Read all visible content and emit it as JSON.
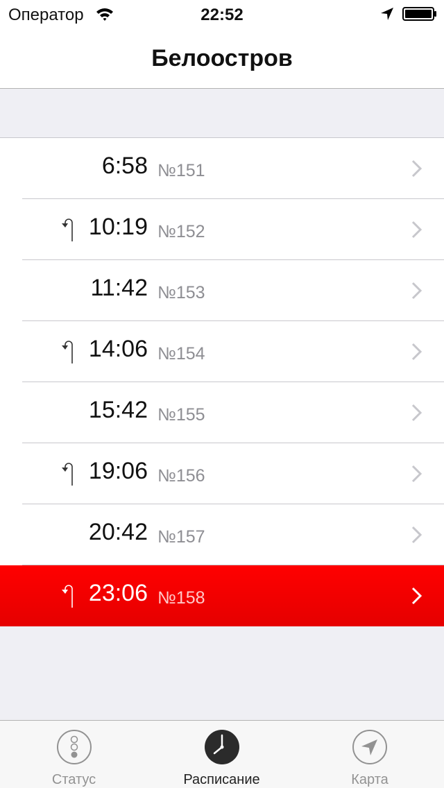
{
  "status_bar": {
    "carrier": "Оператор",
    "time": "22:52"
  },
  "nav": {
    "title": "Белоостров"
  },
  "rows": [
    {
      "time": "6:58",
      "number": "№151",
      "turn": false,
      "highlighted": false
    },
    {
      "time": "10:19",
      "number": "№152",
      "turn": true,
      "highlighted": false
    },
    {
      "time": "11:42",
      "number": "№153",
      "turn": false,
      "highlighted": false
    },
    {
      "time": "14:06",
      "number": "№154",
      "turn": true,
      "highlighted": false
    },
    {
      "time": "15:42",
      "number": "№155",
      "turn": false,
      "highlighted": false
    },
    {
      "time": "19:06",
      "number": "№156",
      "turn": true,
      "highlighted": false
    },
    {
      "time": "20:42",
      "number": "№157",
      "turn": false,
      "highlighted": false
    },
    {
      "time": "23:06",
      "number": "№158",
      "turn": true,
      "highlighted": true
    }
  ],
  "tabs": [
    {
      "label": "Статус",
      "icon": "traffic-light-icon",
      "active": false
    },
    {
      "label": "Расписание",
      "icon": "clock-icon",
      "active": true
    },
    {
      "label": "Карта",
      "icon": "location-arrow-icon",
      "active": false
    }
  ],
  "colors": {
    "highlight": "#ff0000",
    "background": "#efeff4",
    "secondary_text": "#8e8e93"
  }
}
